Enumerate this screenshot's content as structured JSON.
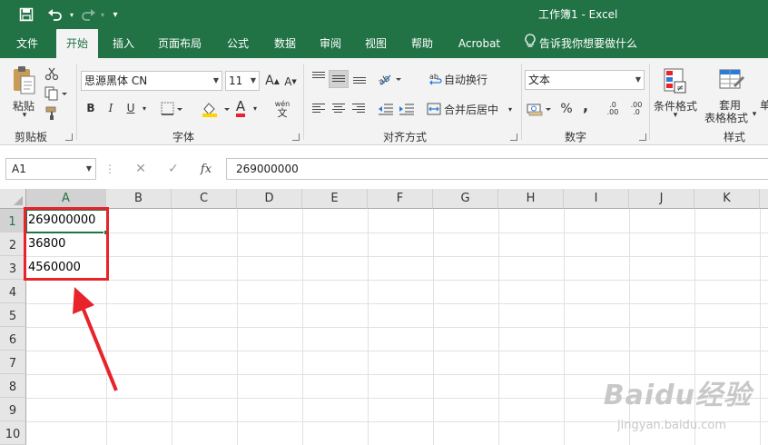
{
  "window": {
    "title": "工作簿1  -  Excel"
  },
  "quick_access": {
    "save_icon": "save-icon",
    "undo_icon": "undo-icon",
    "redo_icon": "redo-icon",
    "customize_icon": "chevron-down-icon"
  },
  "tabs": [
    {
      "label": "文件"
    },
    {
      "label": "开始",
      "active": true
    },
    {
      "label": "插入"
    },
    {
      "label": "页面布局"
    },
    {
      "label": "公式"
    },
    {
      "label": "数据"
    },
    {
      "label": "审阅"
    },
    {
      "label": "视图"
    },
    {
      "label": "帮助"
    },
    {
      "label": "Acrobat"
    }
  ],
  "tell_me": "告诉我你想要做什么",
  "ribbon": {
    "clipboard": {
      "label": "剪贴板",
      "paste": "粘贴"
    },
    "font": {
      "label": "字体",
      "font_name": "思源黑体 CN",
      "font_size": "11",
      "grow": "A",
      "shrink": "A",
      "bold": "B",
      "italic": "I",
      "underline": "U",
      "fill_letter": "A",
      "wen": "wén",
      "wen_char": "文"
    },
    "alignment": {
      "label": "对齐方式",
      "wrap": "自动换行",
      "merge": "合并后居中"
    },
    "number": {
      "label": "数字",
      "format": "文本",
      "percent": "%",
      "comma": ",",
      "inc": ".00",
      "dec": ".0"
    },
    "styles": {
      "label": "样式",
      "cond_format": "条件格式",
      "table_format_1": "套用",
      "table_format_2": "表格格式",
      "cell_styles_partial": "单"
    }
  },
  "formula_bar": {
    "name_box": "A1",
    "fx": "fx",
    "value": "269000000"
  },
  "sheet": {
    "columns": [
      "A",
      "B",
      "C",
      "D",
      "E",
      "F",
      "G",
      "H",
      "I",
      "J",
      "K"
    ],
    "rows": [
      "1",
      "2",
      "3",
      "4",
      "5",
      "6",
      "7",
      "8",
      "9",
      "10"
    ],
    "cells": [
      {
        "ref": "A1",
        "value": "269000000"
      },
      {
        "ref": "A2",
        "value": "36800"
      },
      {
        "ref": "A3",
        "value": "4560000"
      }
    ],
    "active_cell": "A1"
  },
  "annotation": {
    "box_color": "#e8232b",
    "arrow_color": "#e8232b"
  },
  "watermark": {
    "brand": "Baidu经验",
    "url": "jingyan.baidu.com"
  },
  "colors": {
    "excel_green": "#217346",
    "ribbon_bg": "#f3f3f3"
  }
}
